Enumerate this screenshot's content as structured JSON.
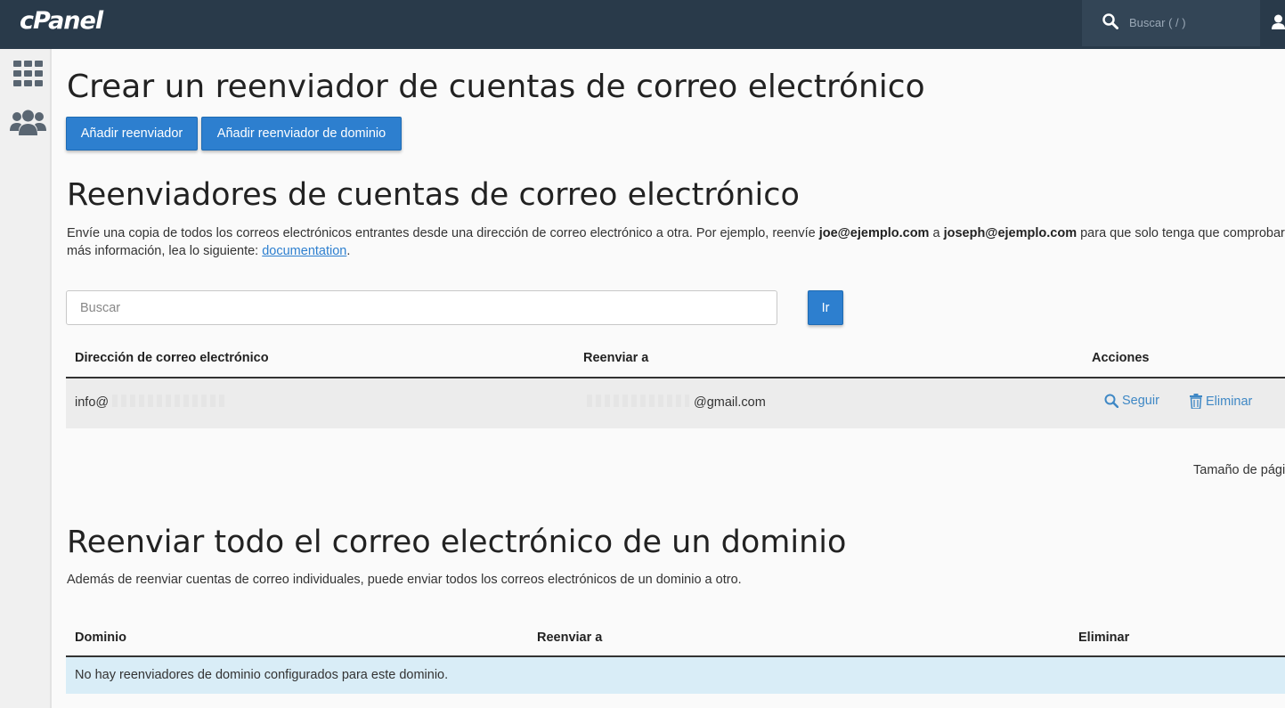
{
  "header": {
    "logo": "cPanel",
    "search_placeholder": "Buscar ( / )"
  },
  "page": {
    "title": "Crear un reenviador de cuentas de correo electrónico",
    "buttons": {
      "add_forwarder": "Añadir reenviador",
      "add_domain_forwarder": "Añadir reenviador de dominio"
    }
  },
  "forwarders": {
    "heading": "Reenviadores de cuentas de correo electrónico",
    "desc": {
      "part1": "Envíe una copia de todos los correos electrónicos entrantes desde una dirección de correo electrónico a otra. Por ejemplo, reenvíe ",
      "example_from": "joe@ejemplo.com",
      "part2": " a ",
      "example_to": "joseph@ejemplo.com",
      "part3": " para que solo tenga que comprobar",
      "line2_prefix": "más información, lea lo siguiente: ",
      "doc_link": "documentation",
      "line2_suffix": "."
    },
    "search_placeholder": "Buscar",
    "go_button": "Ir",
    "columns": [
      "Dirección de correo electrónico",
      "Reenviar a",
      "Acciones"
    ],
    "rows": [
      {
        "email": "info@",
        "forward_to": "@gmail.com",
        "action_track": "Seguir",
        "action_delete": "Eliminar"
      }
    ],
    "page_size_label": "Tamaño de pági"
  },
  "domain_forwarding": {
    "heading": "Reenviar todo el correo electrónico de un dominio",
    "desc": "Además de reenviar cuentas de correo individuales, puede enviar todos los correos electrónicos de un dominio a otro.",
    "columns": [
      "Dominio",
      "Reenviar a",
      "Eliminar"
    ],
    "empty_message": "No hay reenviadores de dominio configurados para este dominio."
  },
  "colors": {
    "topbar": "#293a4a",
    "primary_button": "#2d7fcf",
    "link": "#3f88c5",
    "info_row": "#d9edf7"
  }
}
